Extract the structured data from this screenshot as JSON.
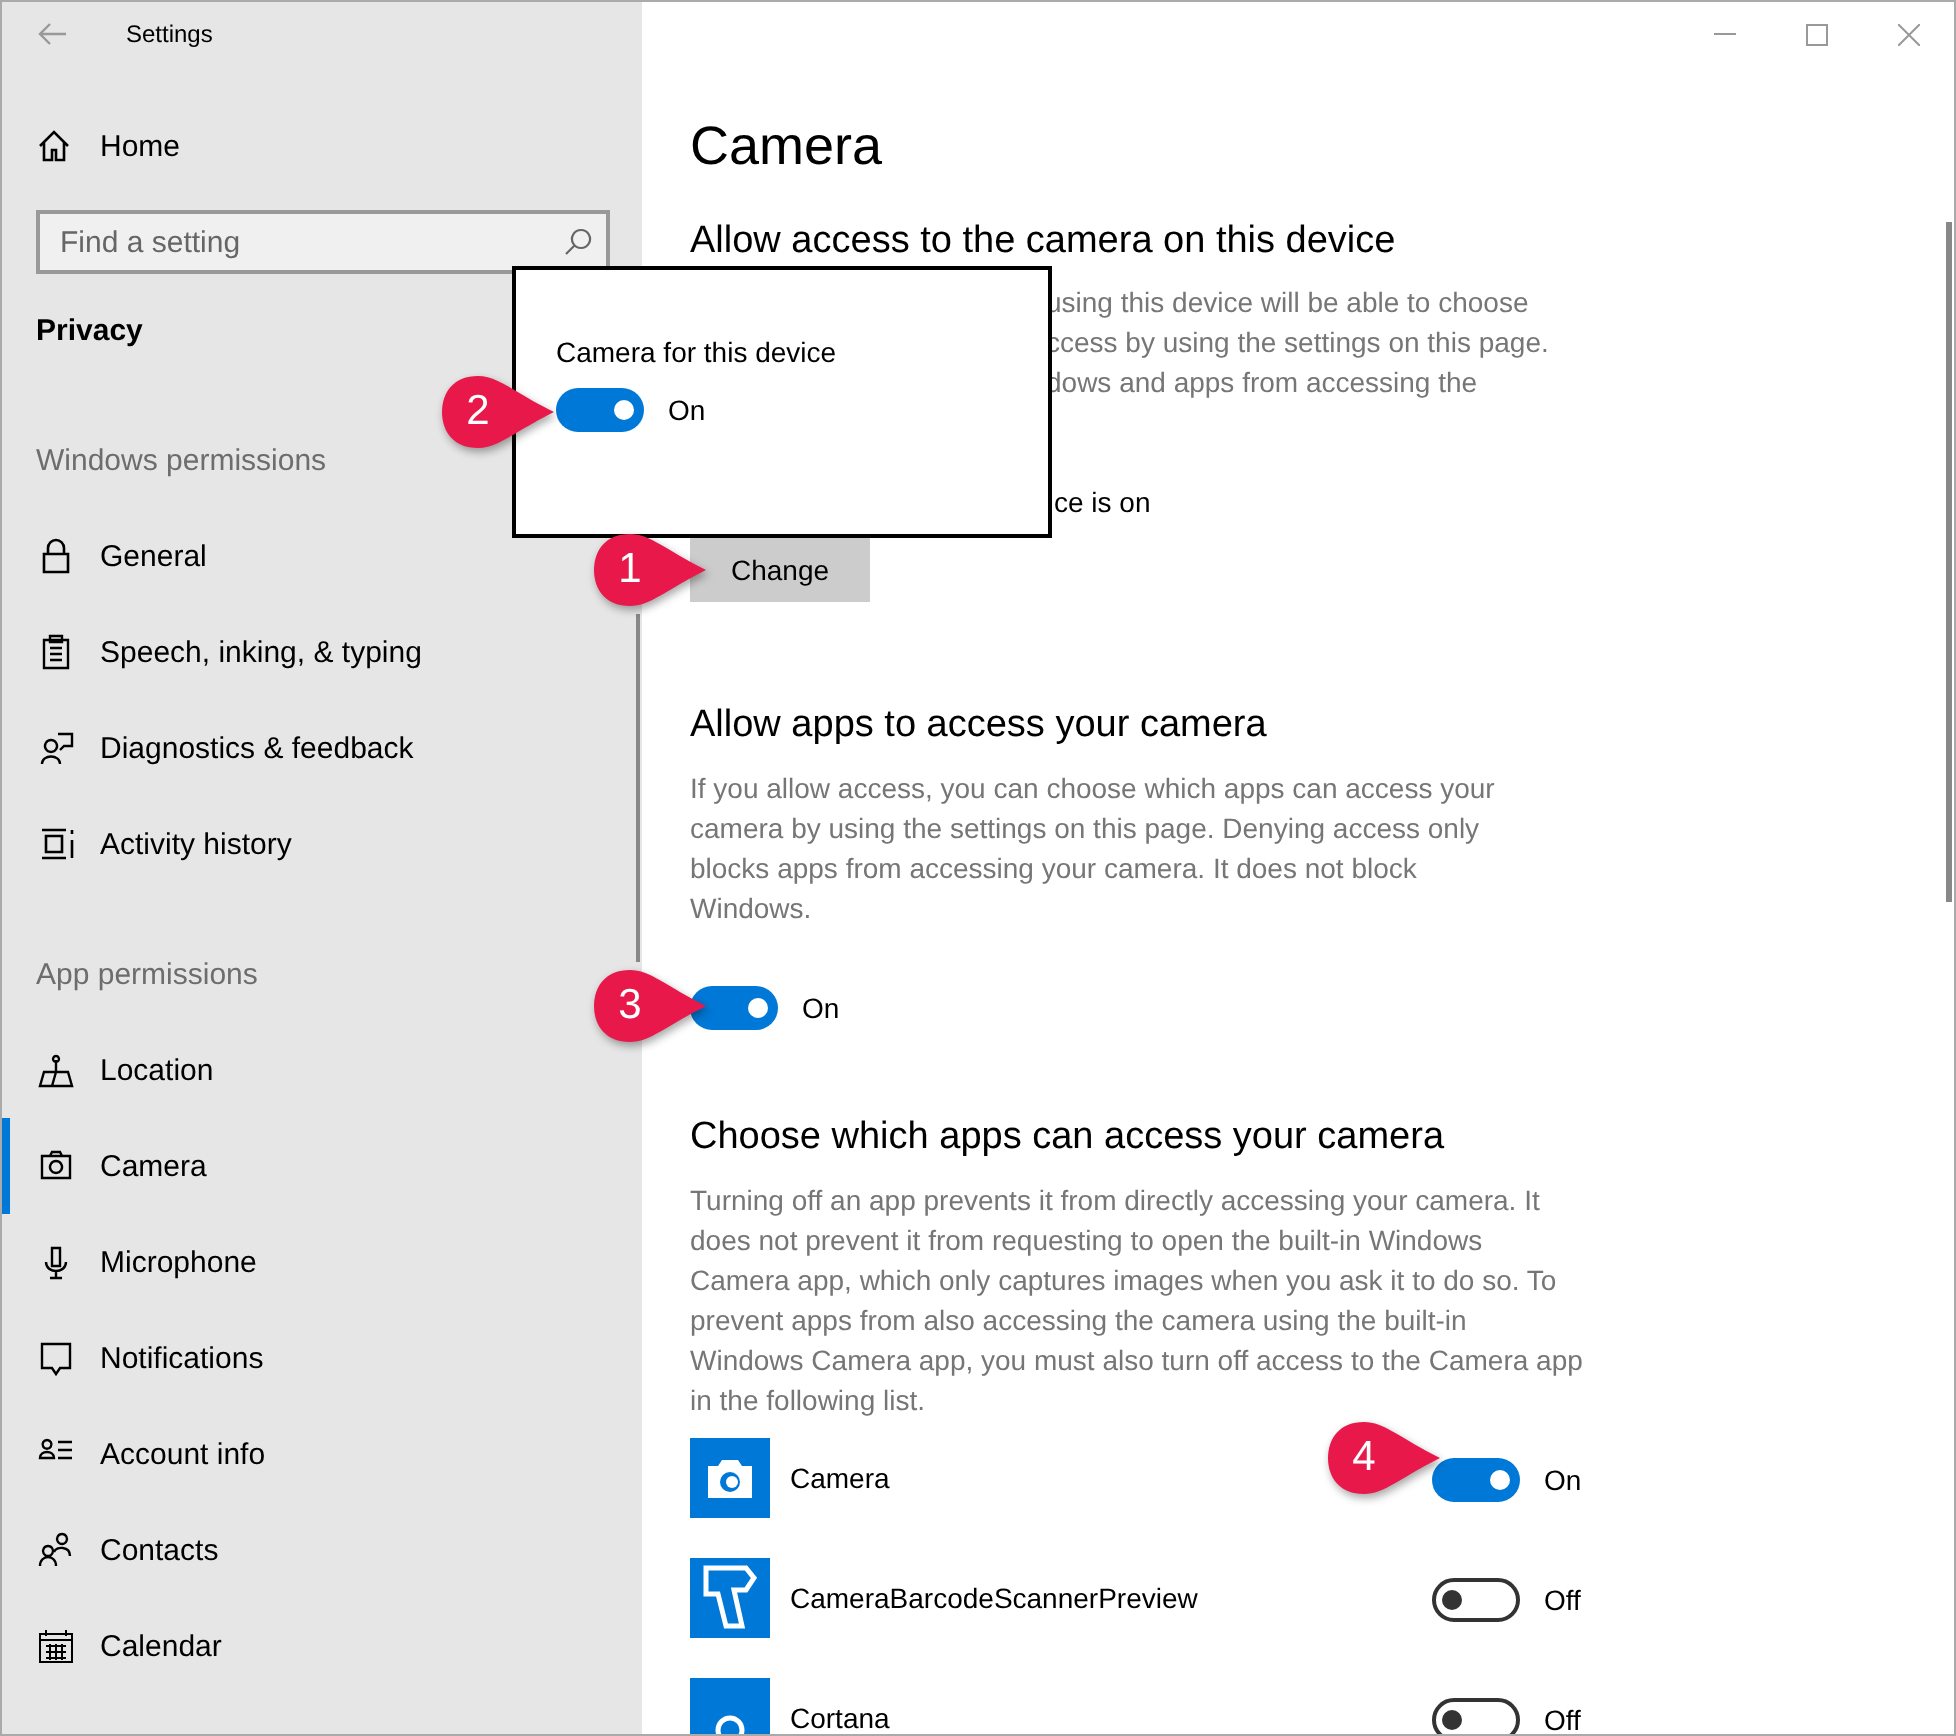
{
  "window": {
    "title": "Settings"
  },
  "sidebar": {
    "home": "Home",
    "search": {
      "placeholder": "Find a setting"
    },
    "category": "Privacy",
    "groups": [
      {
        "heading": "Windows permissions",
        "items": [
          {
            "label": "General",
            "selected": false
          },
          {
            "label": "Speech, inking, & typing",
            "selected": false
          },
          {
            "label": "Diagnostics & feedback",
            "selected": false
          },
          {
            "label": "Activity history",
            "selected": false
          }
        ]
      },
      {
        "heading": "App permissions",
        "items": [
          {
            "label": "Location",
            "selected": false
          },
          {
            "label": "Camera",
            "selected": true
          },
          {
            "label": "Microphone",
            "selected": false
          },
          {
            "label": "Notifications",
            "selected": false
          },
          {
            "label": "Account info",
            "selected": false
          },
          {
            "label": "Contacts",
            "selected": false
          },
          {
            "label": "Calendar",
            "selected": false
          }
        ]
      }
    ]
  },
  "page": {
    "title": "Camera",
    "device_section": {
      "heading": "Allow access to the camera on this device",
      "description_lines": [
        "using this device will be able to choose",
        "ccess by using the settings on this page.",
        "dows and apps from accessing the"
      ],
      "status": "ce is on",
      "button": "Change"
    },
    "apps_section": {
      "heading": "Allow apps to access your camera",
      "description": "If you allow access, you can choose which apps can access your camera by using the settings on this page. Denying access only blocks apps from accessing your camera. It does not block Windows.",
      "toggle": {
        "on": true,
        "label": "On"
      }
    },
    "list_section": {
      "heading": "Choose which apps can access your camera",
      "description": "Turning off an app prevents it from directly accessing your camera. It does not prevent it from requesting to open the built-in Windows Camera app, which only captures images when you ask it to do so. To prevent apps from also accessing the camera using the built-in Windows Camera app, you must also turn off access to the Camera app in the following list.",
      "apps": [
        {
          "name": "Camera",
          "on": true,
          "label": "On"
        },
        {
          "name": "CameraBarcodeScannerPreview",
          "on": false,
          "label": "Off"
        },
        {
          "name": "Cortana",
          "on": false,
          "label": "Off"
        }
      ]
    }
  },
  "popup": {
    "label": "Camera for this device",
    "toggle": {
      "on": true,
      "label": "On"
    }
  },
  "callouts": [
    {
      "number": "1"
    },
    {
      "number": "2"
    },
    {
      "number": "3"
    },
    {
      "number": "4"
    }
  ]
}
